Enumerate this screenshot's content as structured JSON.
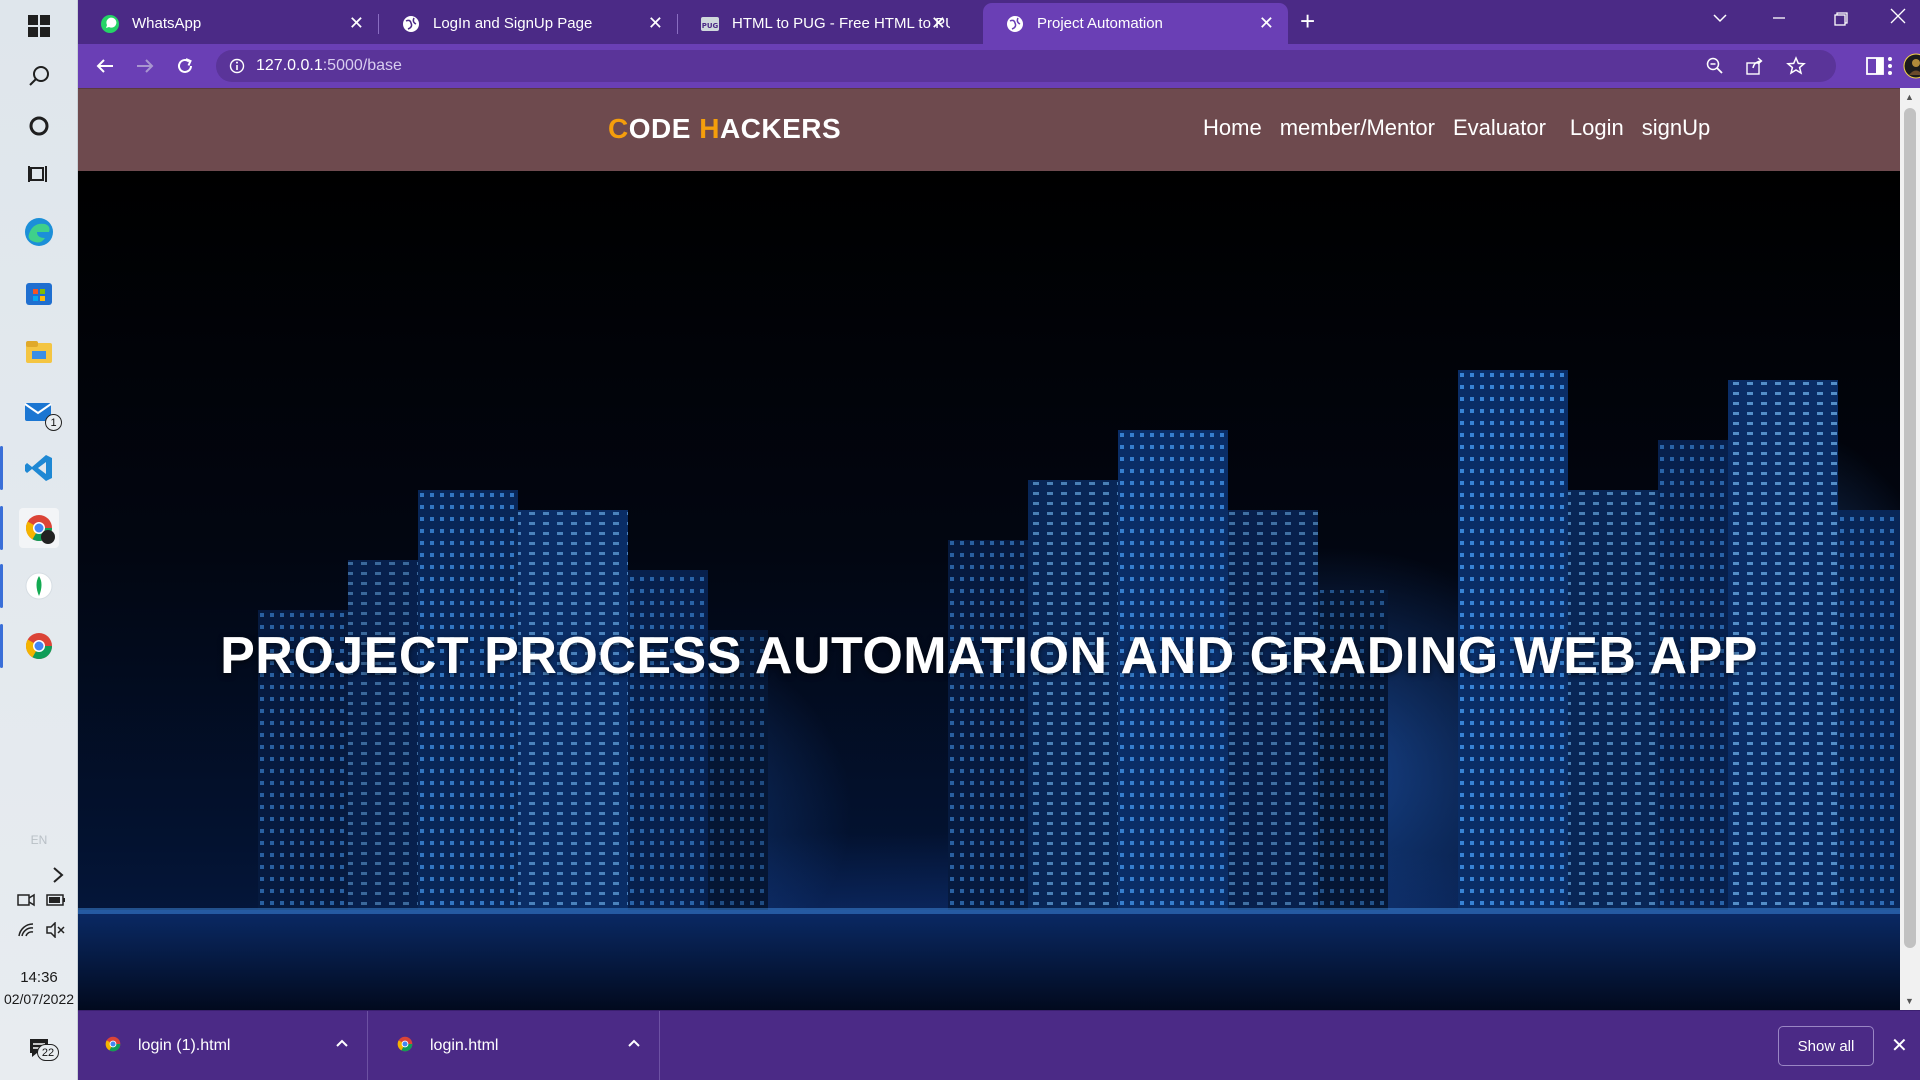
{
  "taskbar": {
    "mail_badge": "1",
    "language": "EN",
    "time": "14:36",
    "date": "02/07/2022",
    "notifications_count": "22"
  },
  "browser": {
    "tabs": [
      {
        "title": "WhatsApp",
        "icon": "whatsapp-icon"
      },
      {
        "title": "LogIn and SignUp Page",
        "icon": "globe-icon"
      },
      {
        "title": "HTML to PUG - Free HTML to PUG",
        "icon": "pug-icon"
      },
      {
        "title": "Project Automation",
        "icon": "globe-icon"
      }
    ],
    "url_host": "127.0.0.1",
    "url_rest": ":5000/base"
  },
  "navbar": {
    "brand_c": "C",
    "brand_ode": "ODE ",
    "brand_h": "H",
    "brand_ackers": "ACKERS",
    "links": [
      "Home",
      "member/Mentor",
      "Evaluator",
      "Login",
      "signUp"
    ]
  },
  "hero": {
    "title": "PROJECT PROCESS AUTOMATION AND GRADING WEB APP"
  },
  "downloads": {
    "items": [
      "login (1).html",
      "login.html"
    ],
    "show_all": "Show all"
  },
  "colors": {
    "chrome_dark": "#4b2a86",
    "chrome_light": "#6a3fb5",
    "navbar": "#6e4a4e",
    "brand_accent": "#f59e0b"
  }
}
